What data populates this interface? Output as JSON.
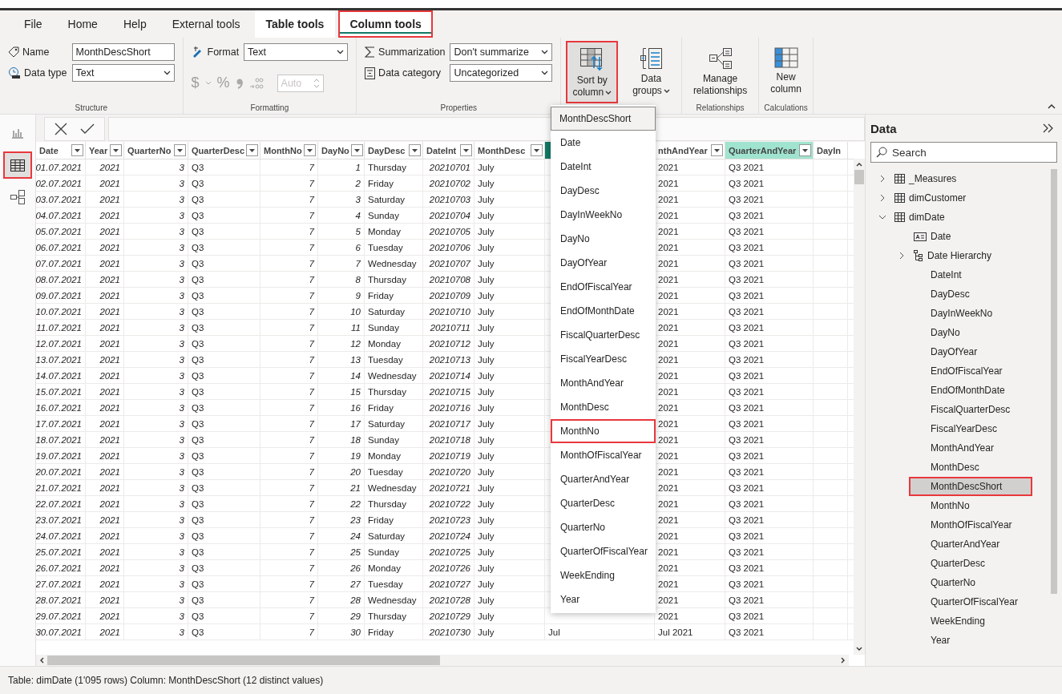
{
  "ribbon_tabs": [
    {
      "label": "File",
      "kind": "standard",
      "selected": false,
      "highlighted": false
    },
    {
      "label": "Home",
      "kind": "standard",
      "selected": false,
      "highlighted": false
    },
    {
      "label": "Help",
      "kind": "standard",
      "selected": false,
      "highlighted": false
    },
    {
      "label": "External tools",
      "kind": "standard",
      "selected": false,
      "highlighted": false
    },
    {
      "label": "Table tools",
      "kind": "contextual",
      "selected": false,
      "highlighted": false
    },
    {
      "label": "Column tools",
      "kind": "contextual",
      "selected": true,
      "highlighted": true
    }
  ],
  "ribbon": {
    "structure": {
      "group_label": "Structure",
      "name_label": "Name",
      "name_value": "MonthDescShort",
      "data_type_label": "Data type",
      "data_type_value": "Text"
    },
    "formatting": {
      "group_label": "Formatting",
      "format_label": "Format",
      "format_value": "Text",
      "currency_button": "$",
      "percent_button": "%",
      "decimals_placeholder": "Auto",
      "disabled": true
    },
    "properties": {
      "group_label": "Properties",
      "summarization_label": "Summarization",
      "summarization_value": "Don't summarize",
      "category_label": "Data category",
      "category_value": "Uncategorized"
    },
    "groups": [
      {
        "buttons": [
          {
            "label": "Sort by\ncolumn",
            "kind": "sort",
            "dropdown": true,
            "highlighted": true
          },
          {
            "label": "Data\ngroups",
            "kind": "groups",
            "dropdown": true,
            "highlighted": false
          }
        ]
      },
      {
        "label": "Relationships",
        "buttons": [
          {
            "label": "Manage\nrelationships",
            "kind": "relationships",
            "dropdown": false,
            "highlighted": false
          }
        ]
      },
      {
        "label": "Calculations",
        "buttons": [
          {
            "label": "New\ncolumn",
            "kind": "new-column",
            "dropdown": false,
            "highlighted": false
          }
        ]
      }
    ]
  },
  "views": [
    {
      "kind": "report",
      "selected": false,
      "highlighted": false
    },
    {
      "kind": "table",
      "selected": true,
      "highlighted": true
    },
    {
      "kind": "model",
      "selected": false,
      "highlighted": false
    }
  ],
  "table": {
    "columns": [
      {
        "label": "Date",
        "kind": "number",
        "filter": true,
        "selected": false,
        "hovered": false
      },
      {
        "label": "Year",
        "kind": "number",
        "filter": true,
        "selected": false,
        "hovered": false
      },
      {
        "label": "QuarterNo",
        "kind": "number",
        "filter": true,
        "selected": false,
        "hovered": false
      },
      {
        "label": "QuarterDesc",
        "kind": "text",
        "filter": true,
        "selected": false,
        "hovered": false
      },
      {
        "label": "MonthNo",
        "kind": "number",
        "filter": true,
        "selected": false,
        "hovered": false
      },
      {
        "label": "DayNo",
        "kind": "number",
        "filter": true,
        "selected": false,
        "hovered": false
      },
      {
        "label": "DayDesc",
        "kind": "text",
        "filter": true,
        "selected": false,
        "hovered": false
      },
      {
        "label": "DateInt",
        "kind": "number",
        "filter": true,
        "selected": false,
        "hovered": false
      },
      {
        "label": "MonthDesc",
        "kind": "text",
        "filter": true,
        "selected": false,
        "hovered": false
      },
      {
        "kind": "text",
        "filter": false,
        "selected": true,
        "hovered": false
      },
      {
        "label": "nthAndYear",
        "kind": "text",
        "filter": true,
        "selected": false,
        "hovered": false
      },
      {
        "label": "QuarterAndYear",
        "kind": "text",
        "filter": true,
        "selected": false,
        "hovered": true
      },
      {
        "label": "DayIn",
        "kind": "text",
        "filter": false,
        "selected": false,
        "hovered": false
      }
    ],
    "rows": [
      [
        "01.07.2021",
        "2021",
        "3",
        "Q3",
        "7",
        "1",
        "Thursday",
        "20210701",
        "July",
        null,
        "2021",
        "Q3 2021",
        null
      ],
      [
        "02.07.2021",
        "2021",
        "3",
        "Q3",
        "7",
        "2",
        "Friday",
        "20210702",
        "July",
        null,
        "2021",
        "Q3 2021",
        null
      ],
      [
        "03.07.2021",
        "2021",
        "3",
        "Q3",
        "7",
        "3",
        "Saturday",
        "20210703",
        "July",
        null,
        "2021",
        "Q3 2021",
        null
      ],
      [
        "04.07.2021",
        "2021",
        "3",
        "Q3",
        "7",
        "4",
        "Sunday",
        "20210704",
        "July",
        null,
        "2021",
        "Q3 2021",
        null
      ],
      [
        "05.07.2021",
        "2021",
        "3",
        "Q3",
        "7",
        "5",
        "Monday",
        "20210705",
        "July",
        null,
        "2021",
        "Q3 2021",
        null
      ],
      [
        "06.07.2021",
        "2021",
        "3",
        "Q3",
        "7",
        "6",
        "Tuesday",
        "20210706",
        "July",
        null,
        "2021",
        "Q3 2021",
        null
      ],
      [
        "07.07.2021",
        "2021",
        "3",
        "Q3",
        "7",
        "7",
        "Wednesday",
        "20210707",
        "July",
        null,
        "2021",
        "Q3 2021",
        null
      ],
      [
        "08.07.2021",
        "2021",
        "3",
        "Q3",
        "7",
        "8",
        "Thursday",
        "20210708",
        "July",
        null,
        "2021",
        "Q3 2021",
        null
      ],
      [
        "09.07.2021",
        "2021",
        "3",
        "Q3",
        "7",
        "9",
        "Friday",
        "20210709",
        "July",
        null,
        "2021",
        "Q3 2021",
        null
      ],
      [
        "10.07.2021",
        "2021",
        "3",
        "Q3",
        "7",
        "10",
        "Saturday",
        "20210710",
        "July",
        null,
        "2021",
        "Q3 2021",
        null
      ],
      [
        "11.07.2021",
        "2021",
        "3",
        "Q3",
        "7",
        "11",
        "Sunday",
        "20210711",
        "July",
        null,
        "2021",
        "Q3 2021",
        null
      ],
      [
        "12.07.2021",
        "2021",
        "3",
        "Q3",
        "7",
        "12",
        "Monday",
        "20210712",
        "July",
        null,
        "2021",
        "Q3 2021",
        null
      ],
      [
        "13.07.2021",
        "2021",
        "3",
        "Q3",
        "7",
        "13",
        "Tuesday",
        "20210713",
        "July",
        null,
        "2021",
        "Q3 2021",
        null
      ],
      [
        "14.07.2021",
        "2021",
        "3",
        "Q3",
        "7",
        "14",
        "Wednesday",
        "20210714",
        "July",
        null,
        "2021",
        "Q3 2021",
        null
      ],
      [
        "15.07.2021",
        "2021",
        "3",
        "Q3",
        "7",
        "15",
        "Thursday",
        "20210715",
        "July",
        null,
        "2021",
        "Q3 2021",
        null
      ],
      [
        "16.07.2021",
        "2021",
        "3",
        "Q3",
        "7",
        "16",
        "Friday",
        "20210716",
        "July",
        null,
        "2021",
        "Q3 2021",
        null
      ],
      [
        "17.07.2021",
        "2021",
        "3",
        "Q3",
        "7",
        "17",
        "Saturday",
        "20210717",
        "July",
        null,
        "2021",
        "Q3 2021",
        null
      ],
      [
        "18.07.2021",
        "2021",
        "3",
        "Q3",
        "7",
        "18",
        "Sunday",
        "20210718",
        "July",
        null,
        "2021",
        "Q3 2021",
        null
      ],
      [
        "19.07.2021",
        "2021",
        "3",
        "Q3",
        "7",
        "19",
        "Monday",
        "20210719",
        "July",
        null,
        "2021",
        "Q3 2021",
        null
      ],
      [
        "20.07.2021",
        "2021",
        "3",
        "Q3",
        "7",
        "20",
        "Tuesday",
        "20210720",
        "July",
        null,
        "2021",
        "Q3 2021",
        null
      ],
      [
        "21.07.2021",
        "2021",
        "3",
        "Q3",
        "7",
        "21",
        "Wednesday",
        "20210721",
        "July",
        null,
        "2021",
        "Q3 2021",
        null
      ],
      [
        "22.07.2021",
        "2021",
        "3",
        "Q3",
        "7",
        "22",
        "Thursday",
        "20210722",
        "July",
        null,
        "2021",
        "Q3 2021",
        null
      ],
      [
        "23.07.2021",
        "2021",
        "3",
        "Q3",
        "7",
        "23",
        "Friday",
        "20210723",
        "July",
        null,
        "2021",
        "Q3 2021",
        null
      ],
      [
        "24.07.2021",
        "2021",
        "3",
        "Q3",
        "7",
        "24",
        "Saturday",
        "20210724",
        "July",
        null,
        "2021",
        "Q3 2021",
        null
      ],
      [
        "25.07.2021",
        "2021",
        "3",
        "Q3",
        "7",
        "25",
        "Sunday",
        "20210725",
        "July",
        null,
        "2021",
        "Q3 2021",
        null
      ],
      [
        "26.07.2021",
        "2021",
        "3",
        "Q3",
        "7",
        "26",
        "Monday",
        "20210726",
        "July",
        null,
        "2021",
        "Q3 2021",
        null
      ],
      [
        "27.07.2021",
        "2021",
        "3",
        "Q3",
        "7",
        "27",
        "Tuesday",
        "20210727",
        "July",
        null,
        "2021",
        "Q3 2021",
        null
      ],
      [
        "28.07.2021",
        "2021",
        "3",
        "Q3",
        "7",
        "28",
        "Wednesday",
        "20210728",
        "July",
        null,
        "2021",
        "Q3 2021",
        null
      ],
      [
        "29.07.2021",
        "2021",
        "3",
        "Q3",
        "7",
        "29",
        "Thursday",
        "20210729",
        "July",
        null,
        "2021",
        "Q3 2021",
        null
      ],
      [
        "30.07.2021",
        "2021",
        "3",
        "Q3",
        "7",
        "30",
        "Friday",
        "20210730",
        "July",
        "Jul",
        "Jul 2021",
        "Q3 2021",
        null
      ]
    ]
  },
  "sort_menu": {
    "items": [
      {
        "label": "MonthDescShort",
        "selected": true,
        "highlighted": false
      },
      {
        "label": "Date",
        "selected": false,
        "highlighted": false
      },
      {
        "label": "DateInt",
        "selected": false,
        "highlighted": false
      },
      {
        "label": "DayDesc",
        "selected": false,
        "highlighted": false
      },
      {
        "label": "DayInWeekNo",
        "selected": false,
        "highlighted": false
      },
      {
        "label": "DayNo",
        "selected": false,
        "highlighted": false
      },
      {
        "label": "DayOfYear",
        "selected": false,
        "highlighted": false
      },
      {
        "label": "EndOfFiscalYear",
        "selected": false,
        "highlighted": false
      },
      {
        "label": "EndOfMonthDate",
        "selected": false,
        "highlighted": false
      },
      {
        "label": "FiscalQuarterDesc",
        "selected": false,
        "highlighted": false
      },
      {
        "label": "FiscalYearDesc",
        "selected": false,
        "highlighted": false
      },
      {
        "label": "MonthAndYear",
        "selected": false,
        "highlighted": false
      },
      {
        "label": "MonthDesc",
        "selected": false,
        "highlighted": false
      },
      {
        "label": "MonthNo",
        "selected": false,
        "highlighted": true
      },
      {
        "label": "MonthOfFiscalYear",
        "selected": false,
        "highlighted": false
      },
      {
        "label": "QuarterAndYear",
        "selected": false,
        "highlighted": false
      },
      {
        "label": "QuarterDesc",
        "selected": false,
        "highlighted": false
      },
      {
        "label": "QuarterNo",
        "selected": false,
        "highlighted": false
      },
      {
        "label": "QuarterOfFiscalYear",
        "selected": false,
        "highlighted": false
      },
      {
        "label": "WeekEnding",
        "selected": false,
        "highlighted": false
      },
      {
        "label": "Year",
        "selected": false,
        "highlighted": false
      }
    ]
  },
  "data_pane": {
    "title": "Data",
    "search": {
      "placeholder": "Search"
    },
    "tree": [
      {
        "label": "_Measures",
        "kind": "table",
        "expanded": false,
        "selected": false,
        "highlighted": false
      },
      {
        "label": "dimCustomer",
        "kind": "table",
        "expanded": false,
        "selected": false,
        "highlighted": false
      },
      {
        "label": "dimDate",
        "kind": "table",
        "expanded": true,
        "selected": false,
        "highlighted": false,
        "children": [
          {
            "label": "Date",
            "kind": "date-field",
            "selected": false,
            "highlighted": false
          },
          {
            "label": "Date Hierarchy",
            "kind": "hierarchy",
            "expanded": false,
            "selected": false,
            "highlighted": false
          },
          {
            "label": "DateInt",
            "kind": "field",
            "selected": false,
            "highlighted": false
          },
          {
            "label": "DayDesc",
            "kind": "field",
            "selected": false,
            "highlighted": false
          },
          {
            "label": "DayInWeekNo",
            "kind": "field",
            "selected": false,
            "highlighted": false
          },
          {
            "label": "DayNo",
            "kind": "field",
            "selected": false,
            "highlighted": false
          },
          {
            "label": "DayOfYear",
            "kind": "field",
            "selected": false,
            "highlighted": false
          },
          {
            "label": "EndOfFiscalYear",
            "kind": "field",
            "selected": false,
            "highlighted": false
          },
          {
            "label": "EndOfMonthDate",
            "kind": "field",
            "selected": false,
            "highlighted": false
          },
          {
            "label": "FiscalQuarterDesc",
            "kind": "field",
            "selected": false,
            "highlighted": false
          },
          {
            "label": "FiscalYearDesc",
            "kind": "field",
            "selected": false,
            "highlighted": false
          },
          {
            "label": "MonthAndYear",
            "kind": "field",
            "selected": false,
            "highlighted": false
          },
          {
            "label": "MonthDesc",
            "kind": "field",
            "selected": false,
            "highlighted": false
          },
          {
            "label": "MonthDescShort",
            "kind": "field",
            "selected": true,
            "highlighted": true
          },
          {
            "label": "MonthNo",
            "kind": "field",
            "selected": false,
            "highlighted": false
          },
          {
            "label": "MonthOfFiscalYear",
            "kind": "field",
            "selected": false,
            "highlighted": false
          },
          {
            "label": "QuarterAndYear",
            "kind": "field",
            "selected": false,
            "highlighted": false
          },
          {
            "label": "QuarterDesc",
            "kind": "field",
            "selected": false,
            "highlighted": false
          },
          {
            "label": "QuarterNo",
            "kind": "field",
            "selected": false,
            "highlighted": false
          },
          {
            "label": "QuarterOfFiscalYear",
            "kind": "field",
            "selected": false,
            "highlighted": false
          },
          {
            "label": "WeekEnding",
            "kind": "field",
            "selected": false,
            "highlighted": false
          },
          {
            "label": "Year",
            "kind": "field",
            "selected": false,
            "highlighted": false
          }
        ]
      }
    ]
  },
  "status_bar": {
    "text": "Table: dimDate (1'095 rows) Column: MonthDescShort (12 distinct values)"
  }
}
